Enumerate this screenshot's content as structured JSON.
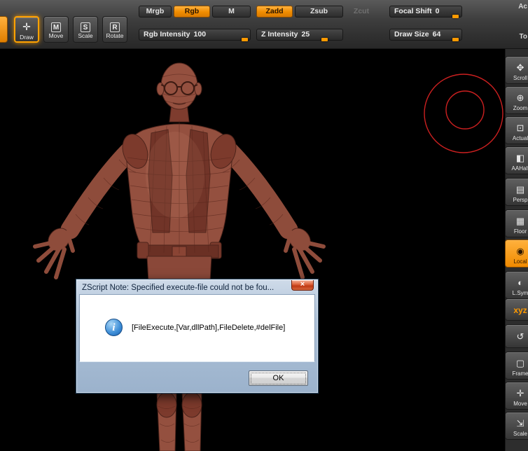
{
  "toolbar": {
    "tools": [
      {
        "label": "Draw",
        "glyph": "✛"
      },
      {
        "label": "Move",
        "glyph": "M"
      },
      {
        "label": "Scale",
        "glyph": "S"
      },
      {
        "label": "Rotate",
        "glyph": "R"
      }
    ],
    "modes": [
      {
        "label": "Mrgb"
      },
      {
        "label": "Rgb"
      },
      {
        "label": "M"
      },
      {
        "label": "Zadd"
      },
      {
        "label": "Zsub"
      },
      {
        "label": "Zcut"
      }
    ],
    "sliders": [
      {
        "label": "Rgb Intensity",
        "value": "100"
      },
      {
        "label": "Z Intensity",
        "value": "25"
      },
      {
        "label": "Focal Shift",
        "value": "0"
      },
      {
        "label": "Draw Size",
        "value": "64"
      }
    ],
    "edge_labels": [
      "Ac",
      "To"
    ]
  },
  "sidebar": {
    "items": [
      {
        "label": "Scroll",
        "glyph": "✥",
        "icon": "scroll-hand-icon"
      },
      {
        "label": "Zoom",
        "glyph": "⊕",
        "icon": "magnifier-icon"
      },
      {
        "label": "Actual",
        "glyph": "⊡",
        "icon": "actual-size-icon"
      },
      {
        "label": "AAHalf",
        "glyph": "◧",
        "icon": "aa-half-icon"
      },
      {
        "label": "Persp",
        "glyph": "▤",
        "icon": "perspective-icon"
      },
      {
        "label": "Floor",
        "glyph": "▦",
        "icon": "floor-grid-icon"
      },
      {
        "label": "Local",
        "glyph": "◉",
        "icon": "local-pivot-icon"
      },
      {
        "label": "L.Sym",
        "glyph": "◐",
        "icon": "symmetry-icon"
      },
      {
        "label": "",
        "glyph": "xyz",
        "icon": "xyz-axis-icon"
      },
      {
        "label": "",
        "glyph": "↺",
        "icon": "rotate-view-icon"
      },
      {
        "label": "Frame",
        "glyph": "▢",
        "icon": "frame-icon"
      },
      {
        "label": "Move",
        "glyph": "✛",
        "icon": "move-view-icon"
      },
      {
        "label": "Scale",
        "glyph": "⇲",
        "icon": "scale-view-icon"
      }
    ]
  },
  "dialog": {
    "title": "ZScript Note: Specified execute-file could not be fou...",
    "message": "[FileExecute,[Var,dllPath],FileDelete,#delFile]",
    "ok_label": "OK",
    "close_glyph": "×",
    "info_glyph": "i"
  },
  "colors": {
    "accent": "#ff9a00",
    "model": "#8f4a3c",
    "cursor_circle": "#cc2020",
    "canvas_bg": "#000000",
    "toolbar_bg": "#3a3a3a"
  }
}
